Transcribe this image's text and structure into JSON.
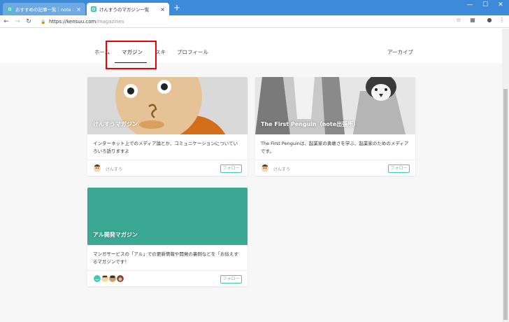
{
  "browser": {
    "tabs": [
      {
        "title": "おすすめの記事一覧｜note ――つ",
        "active": false
      },
      {
        "title": "けんすうのマガジン一覧",
        "active": true
      }
    ],
    "new_tab_symbol": "+",
    "window_controls": {
      "minimize": "—",
      "maximize": "☐",
      "close": "✕"
    },
    "url_host": "https://kensuu.com",
    "url_path": "/magazines"
  },
  "subnav": {
    "items": [
      "ホーム",
      "マガジン",
      "スキ",
      "プロフィール"
    ],
    "active": "マガジン",
    "archive_label": "アーカイブ"
  },
  "cards": [
    {
      "title": "けんすうマガジン",
      "description": "インターネット上でのメディア論とか、コミュニケーションについていろいろ語りますよ",
      "author": "けんすう",
      "follow_label": "フォロー"
    },
    {
      "title": "The First Penguin（note出張所）",
      "description": "The First Penguinは、起業家の勇敢さを学ぶ、起業家のためのメディアです。",
      "author": "けんすう",
      "follow_label": "フォロー"
    },
    {
      "title": "アル開発マガジン",
      "description": "マンガサービスの「アル」での更新情報や開発の裏側などを「お伝えするマガジンです！",
      "follow_label": "フォロー"
    }
  ],
  "colors": {
    "titlebar": "#3c8ad8",
    "accent": "#41c9b4",
    "highlight": "#e00000",
    "teal_card": "#3aa892"
  }
}
